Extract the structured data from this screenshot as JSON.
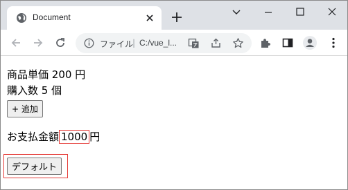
{
  "tab": {
    "title": "Document"
  },
  "omnibox": {
    "label": "ファイル",
    "separator": "|",
    "url": "C:/vue_l..."
  },
  "page": {
    "unit_price_label": "商品単価",
    "unit_price_value": "200",
    "unit_price_unit": "円",
    "quantity_label": "購入数",
    "quantity_value": "5",
    "quantity_unit": "個",
    "add_button": "+ 追加",
    "total_label": "お支払金額",
    "total_value": "1000",
    "total_unit": "円",
    "default_button": "デフォルト"
  },
  "colors": {
    "highlight_border": "#e53935",
    "tabstrip": "#dee1e6"
  }
}
